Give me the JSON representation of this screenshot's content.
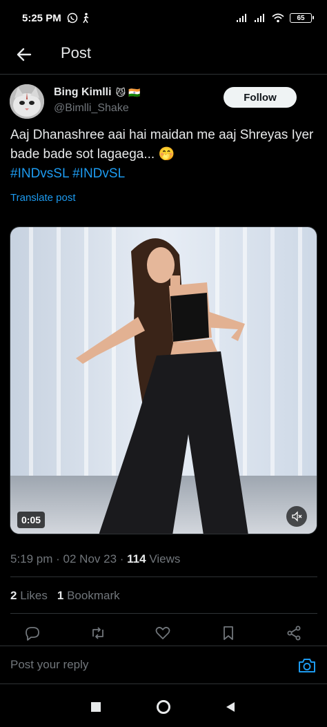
{
  "status_bar": {
    "time": "5:25 PM",
    "battery": "65"
  },
  "header": {
    "title": "Post"
  },
  "author": {
    "name": "Bing Kimlli",
    "emoji": "😼 🇮🇳",
    "handle": "@Bimlli_Shake",
    "follow_label": "Follow"
  },
  "tweet": {
    "text": "Aaj Dhanashree aai hai maidan me aaj Shreyas Iyer bade bade sot lagaega... 🤭",
    "hashtags": "#INDvsSL #INDvSL",
    "translate_label": "Translate post"
  },
  "media": {
    "duration": "0:05"
  },
  "meta": {
    "time": "5:19 pm",
    "date": "02 Nov 23",
    "views_count": "114",
    "views_label": "Views"
  },
  "stats": {
    "likes_count": "2",
    "likes_label": "Likes",
    "bookmarks_count": "1",
    "bookmarks_label": "Bookmark"
  },
  "reply": {
    "placeholder": "Post your reply"
  },
  "colors": {
    "accent": "#1d9bf0",
    "background": "#000000",
    "text": "#e7e9ea",
    "muted": "#71767b"
  }
}
